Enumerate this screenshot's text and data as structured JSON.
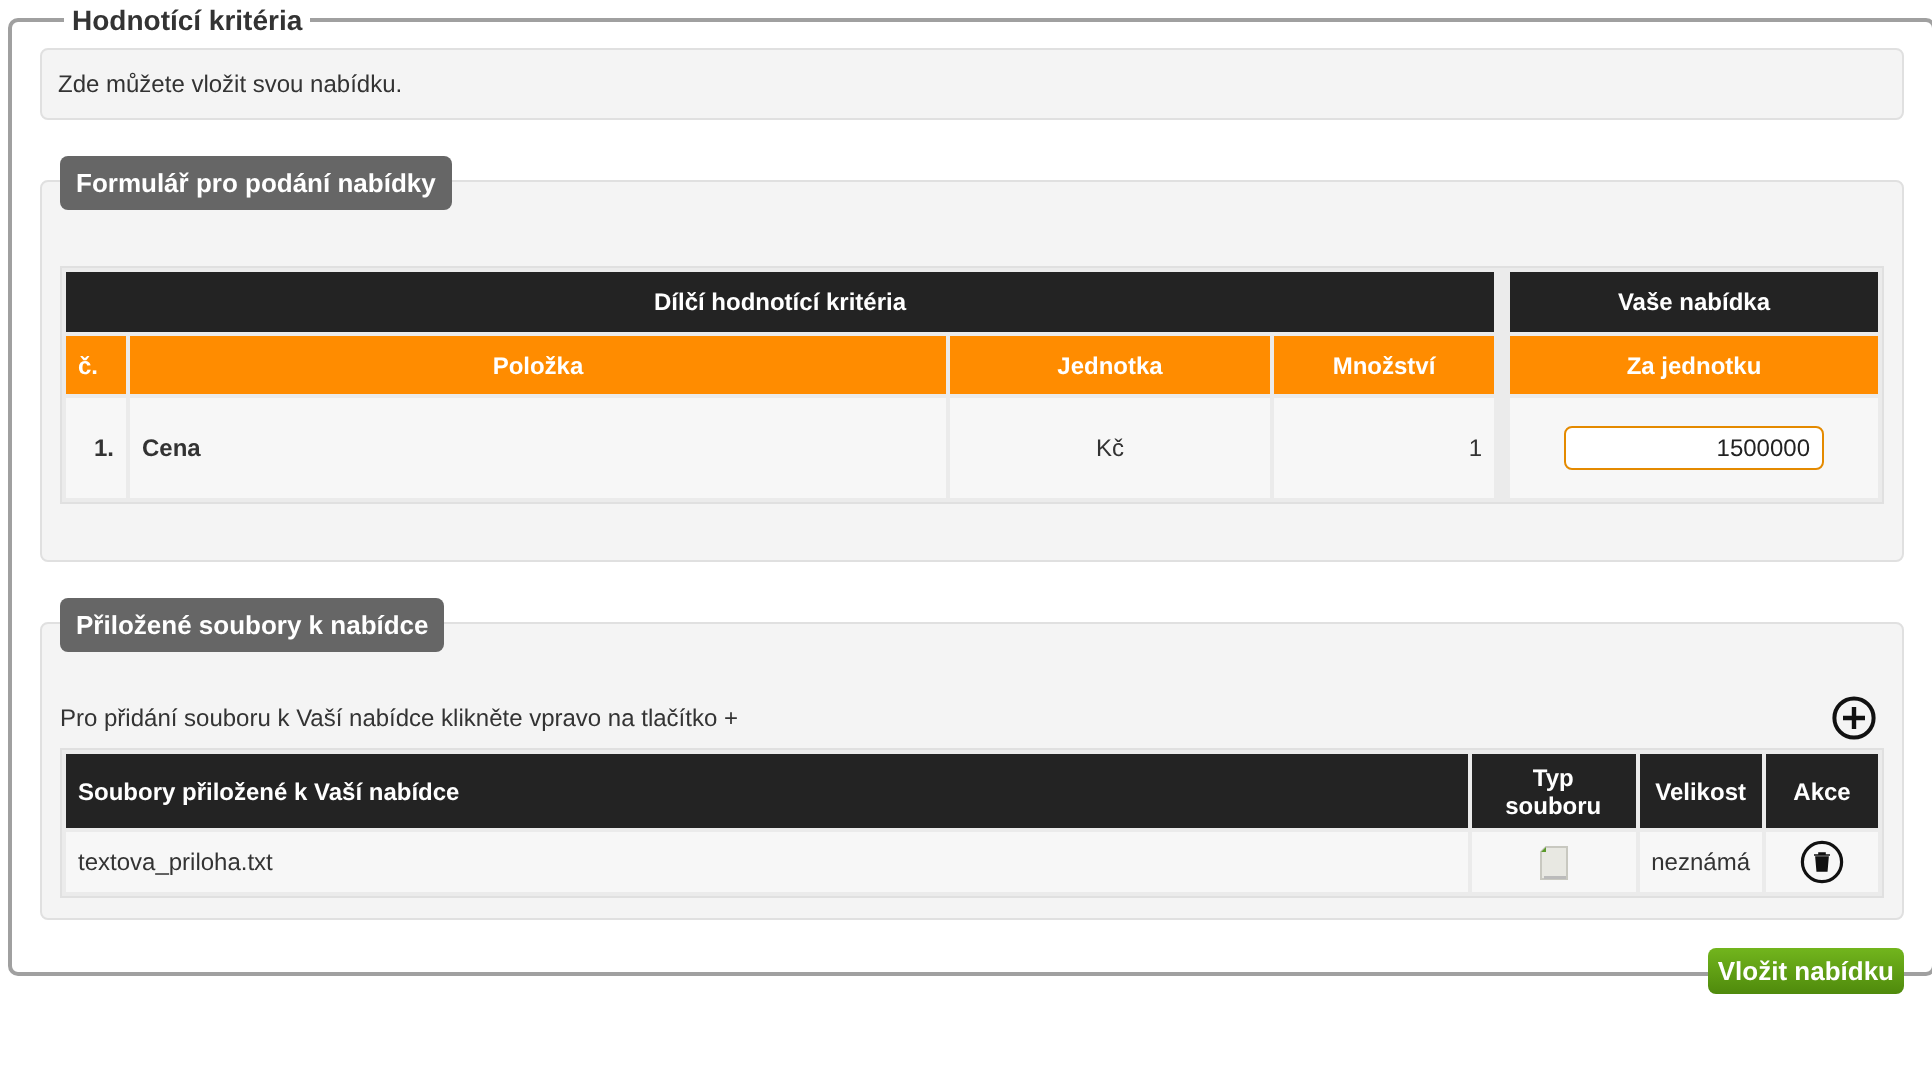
{
  "legend": "Hodnotící kritéria",
  "intro": "Zde můžete vložit svou nabídku.",
  "offer_form": {
    "title": "Formulář pro podání nabídky",
    "group_headers": [
      "Dílčí hodnotící kritéria",
      "Vaše nabídka"
    ],
    "columns": [
      "č.",
      "Položka",
      "Jednotka",
      "Množství",
      "Za jednotku"
    ],
    "rows": [
      {
        "number": "1.",
        "item": "Cena",
        "unit": "Kč",
        "quantity": "1",
        "value": "1500000"
      }
    ]
  },
  "attachments": {
    "title": "Přiložené soubory k nabídce",
    "hint": "Pro přidání souboru k Vaší nabídce klikněte vpravo na tlačítko +",
    "columns": [
      "Soubory přiložené k Vaší nabídce",
      "Typ souboru",
      "Velikost",
      "Akce"
    ],
    "files": [
      {
        "name": "textova_priloha.txt",
        "size": "neznámá"
      }
    ]
  },
  "submit_button": "Vložit nabídku"
}
